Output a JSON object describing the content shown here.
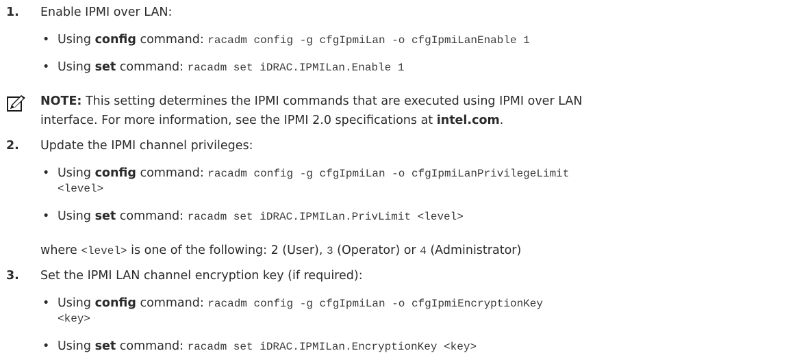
{
  "step1": {
    "number": "1.",
    "text": "Enable IPMI over LAN:",
    "b1_prefix": "Using ",
    "b1_bold": "config",
    "b1_mid": " command: ",
    "b1_code": "racadm config -g cfgIpmiLan -o cfgIpmiLanEnable 1",
    "b2_prefix": "Using ",
    "b2_bold": "set",
    "b2_mid": " command: ",
    "b2_code": "racadm set iDRAC.IPMILan.Enable 1"
  },
  "note": {
    "icon": "pencil-note-icon",
    "label": "NOTE:",
    "line1": " This setting determines the IPMI commands that are executed using IPMI over LAN",
    "line2_prefix": "interface. For more information, see the IPMI 2.0 specifications at ",
    "link": "intel.com",
    "line2_suffix": "."
  },
  "step2": {
    "number": "2.",
    "text": "Update the IPMI channel privileges:",
    "b1_prefix": "Using ",
    "b1_bold": "config",
    "b1_mid": " command: ",
    "b1_code": "racadm config -g cfgIpmiLan -o cfgIpmiLanPrivilegeLimit",
    "b1_code_cont": "<level>",
    "b2_prefix": "Using ",
    "b2_bold": "set",
    "b2_mid": " command: ",
    "b2_code": "racadm set iDRAC.IPMILan.PrivLimit <level>",
    "where_prefix": "where ",
    "where_code": "<level>",
    "where_mid": " is one of the following: 2 (User), ",
    "where_code3": "3",
    "where_op": " (Operator) or ",
    "where_code4": "4",
    "where_admin": " (Administrator)"
  },
  "step3": {
    "number": "3.",
    "text": "Set the IPMI LAN channel encryption key (if required):",
    "b1_prefix": "Using ",
    "b1_bold": "config",
    "b1_mid": " command: ",
    "b1_code": "racadm config -g cfgIpmiLan -o cfgIpmiEncryptionKey",
    "b1_code_cont": "<key>",
    "b2_prefix": "Using ",
    "b2_bold": "set",
    "b2_mid": " command: ",
    "b2_code": "racadm set iDRAC.IPMILan.EncryptionKey <key>"
  }
}
